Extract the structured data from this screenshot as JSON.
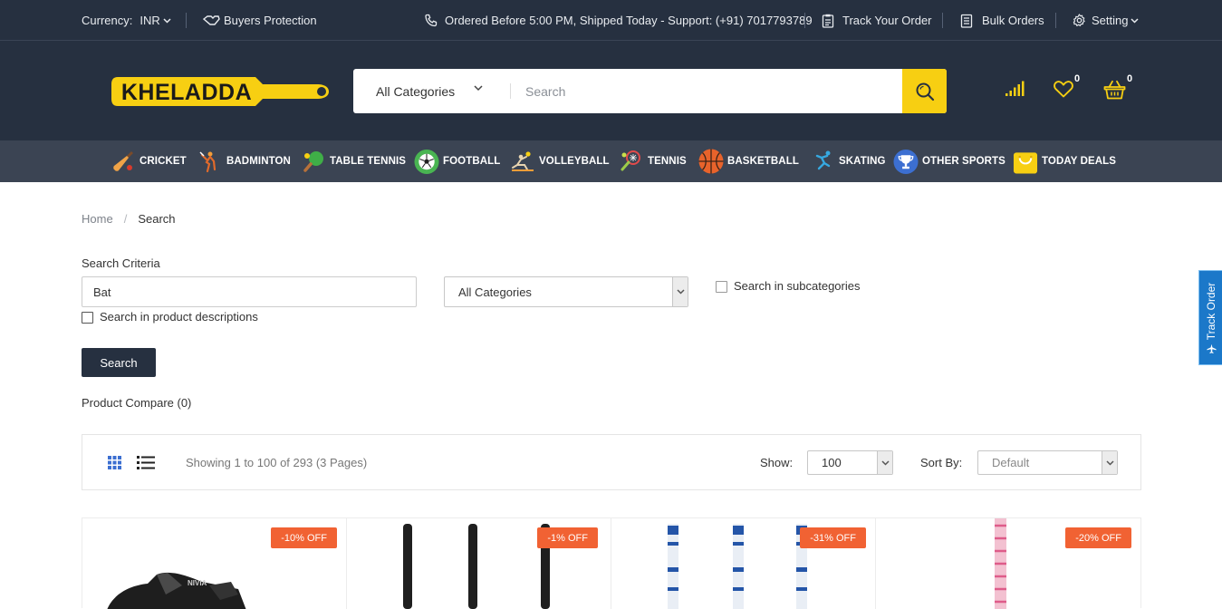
{
  "topbar": {
    "currency_label": "Currency:",
    "currency_value": "INR",
    "buyers_protection": "Buyers Protection",
    "shipping_note": "Ordered Before 5:00 PM, Shipped Today - Support: (+91) 7017793789",
    "track_order": "Track Your Order",
    "bulk_orders": "Bulk Orders",
    "setting": "Setting"
  },
  "header": {
    "logo_text": "KHELADDA",
    "category_select": "All Categories",
    "search_placeholder": "Search",
    "wishlist_count": "0",
    "cart_count": "0"
  },
  "nav": {
    "items": [
      {
        "label": "CRICKET",
        "icon": "cricket-bat-icon"
      },
      {
        "label": "BADMINTON",
        "icon": "badminton-player-icon"
      },
      {
        "label": "TABLE TENNIS",
        "icon": "table-tennis-paddle-icon"
      },
      {
        "label": "FOOTBALL",
        "icon": "football-icon"
      },
      {
        "label": "VOLLEYBALL",
        "icon": "volleyball-player-icon"
      },
      {
        "label": "TENNIS",
        "icon": "tennis-racket-icon"
      },
      {
        "label": "BASKETBALL",
        "icon": "basketball-icon"
      },
      {
        "label": "SKATING",
        "icon": "skater-icon"
      },
      {
        "label": "OTHER SPORTS",
        "icon": "trophy-icon"
      },
      {
        "label": "TODAY DEALS",
        "icon": "shopping-bag-icon"
      }
    ]
  },
  "breadcrumb": {
    "home": "Home",
    "separator": "/",
    "current": "Search"
  },
  "criteria": {
    "title": "Search Criteria",
    "keyword": "Bat",
    "category": "All Categories",
    "subcategories_label": "Search in subcategories",
    "descriptions_label": "Search in product descriptions",
    "button": "Search",
    "compare": "Product Compare (0)"
  },
  "listing": {
    "showing": "Showing 1 to 100 of 293 (3 Pages)",
    "show_label": "Show:",
    "show_value": "100",
    "sort_label": "Sort By:",
    "sort_value": "Default"
  },
  "products": [
    {
      "discount": "-10% OFF"
    },
    {
      "discount": "-1% OFF"
    },
    {
      "discount": "-31% OFF"
    },
    {
      "discount": "-20% OFF"
    }
  ],
  "side_tab": {
    "label": "Track Order"
  },
  "colors": {
    "dark": "#263040",
    "accent": "#f7cf12",
    "badge": "#f16233",
    "track": "#1b78c9"
  }
}
